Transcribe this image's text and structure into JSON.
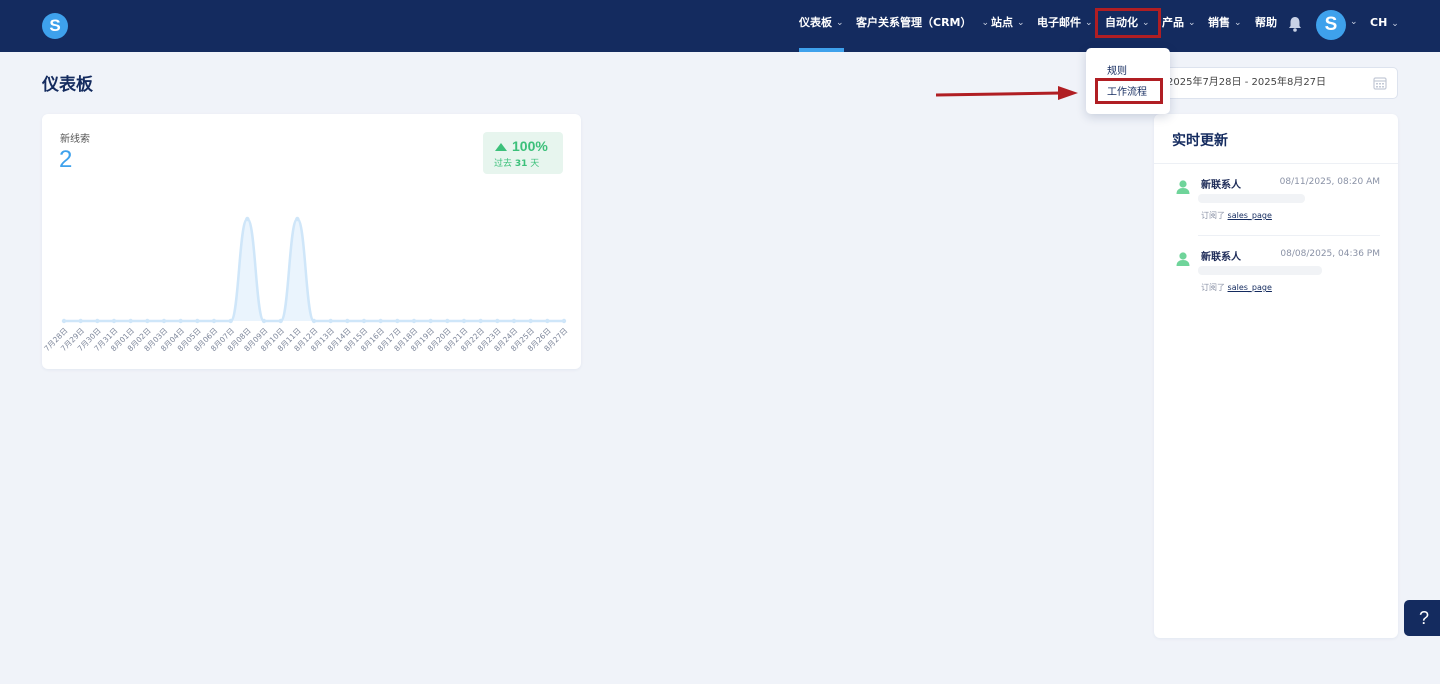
{
  "brand": {
    "logo_letter": "S"
  },
  "nav": {
    "items": [
      {
        "label": "仪表板"
      },
      {
        "label": "客户关系管理（CRM）"
      },
      {
        "label": "站点"
      },
      {
        "label": "电子邮件"
      },
      {
        "label": "自动化"
      },
      {
        "label": "产品"
      },
      {
        "label": "销售"
      },
      {
        "label": "帮助"
      }
    ],
    "avatar_letter": "S",
    "lang": "CH"
  },
  "page": {
    "title": "仪表板"
  },
  "date_range": {
    "value": "2025年7月28日 - 2025年8月27日"
  },
  "automation_menu": {
    "items": [
      {
        "label": "规则"
      },
      {
        "label": "工作流程"
      }
    ]
  },
  "leads_card": {
    "label": "新线索",
    "value": "2",
    "growth": {
      "percent": "100%",
      "period_prefix": "过去",
      "period_days": "31",
      "period_suffix": "天"
    }
  },
  "chart_data": {
    "type": "area",
    "series": [
      {
        "values": [
          0,
          0,
          0,
          0,
          0,
          0,
          0,
          0,
          0,
          0,
          0,
          1,
          0,
          0,
          1,
          0,
          0,
          0,
          0,
          0,
          0,
          0,
          0,
          0,
          0,
          0,
          0,
          0,
          0,
          0,
          0
        ]
      }
    ],
    "x": [
      "7月28日",
      "7月29日",
      "7月30日",
      "7月31日",
      "8月01日",
      "8月02日",
      "8月03日",
      "8月04日",
      "8月05日",
      "8月06日",
      "8月07日",
      "8月08日",
      "8月09日",
      "8月10日",
      "8月11日",
      "8月12日",
      "8月13日",
      "8月14日",
      "8月15日",
      "8月16日",
      "8月17日",
      "8月18日",
      "8月19日",
      "8月20日",
      "8月21日",
      "8月22日",
      "8月23日",
      "8月24日",
      "8月25日",
      "8月26日",
      "8月27日"
    ],
    "ylim": [
      0,
      1
    ],
    "grid": false,
    "color": "#cfe6f9"
  },
  "realtime": {
    "title": "实时更新",
    "items": [
      {
        "name": "新联系人",
        "time": "08/11/2025, 08:20 AM",
        "action": "订阅了",
        "link": "sales_page"
      },
      {
        "name": "新联系人",
        "time": "08/08/2025, 04:36 PM",
        "action": "订阅了",
        "link": "sales_page"
      }
    ]
  },
  "help": {
    "label": "?"
  },
  "colors": {
    "nav_bg": "#142b5f",
    "accent": "#3ea1ec",
    "success": "#3cc07a",
    "highlight": "#b01e23"
  }
}
